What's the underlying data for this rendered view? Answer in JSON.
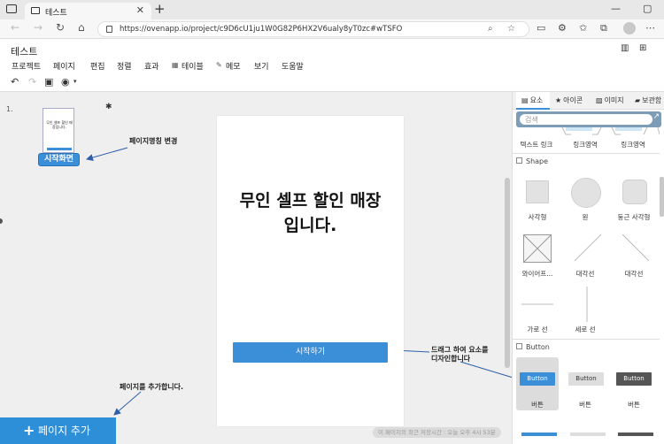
{
  "browser": {
    "tab_title": "테스트",
    "tab_close": "✕",
    "new_tab": "+",
    "window_controls": [
      "—",
      "▢"
    ],
    "url": "https://ovenapp.io/project/c9D6cU1ju1W0G82P6HX2V6ualy8yT0zc#wTSFO",
    "nav": {
      "back": "←",
      "forward": "→",
      "reload": "↻",
      "home": "⌂"
    },
    "toolbar_icons": [
      "search-icon",
      "star-icon",
      "collections-icon",
      "extensions-icon",
      "favorites-icon",
      "profile-icon",
      "more-icon"
    ]
  },
  "app": {
    "title": "테스트",
    "menu": [
      "프로젝트",
      "페이지",
      "편집",
      "정렬",
      "효과",
      "테이블",
      "메모",
      "보기",
      "도움말"
    ],
    "menu_icons": {
      "테이블": "table-icon",
      "메모": "memo-icon"
    },
    "toolbar": [
      "undo-icon",
      "redo-icon",
      "save-icon",
      "preview-icon"
    ]
  },
  "workspace": {
    "page_number": "1.",
    "thumb_title": "무인 셀프 할인 매장입니다.",
    "page_tag": "시작화면",
    "annotations": {
      "page_name_change": "페이지명칭 변경",
      "add_page_hint": "페이지를 추가합니다.",
      "drag_hint_line1": "드래그 하여 요소를",
      "drag_hint_line2": "디자인합니다"
    },
    "canvas": {
      "headline_line1": "무인 셀프 할인 매장",
      "headline_line2": "입니다.",
      "start_button": "시작하기"
    },
    "add_page_button": "페이지 추가",
    "add_page_plus": "+",
    "save_note": "이 페이지의 최근 저장시간 : 오늘 오후 4시 53분"
  },
  "panel": {
    "tabs": [
      {
        "label": "요소",
        "icon": "grid-icon",
        "active": true
      },
      {
        "label": "아이콘",
        "icon": "star-icon",
        "active": false
      },
      {
        "label": "이미지",
        "icon": "image-icon",
        "active": false
      },
      {
        "label": "보관함",
        "icon": "archive-icon",
        "active": false
      }
    ],
    "search_placeholder": "검색",
    "expand_icon": "↗",
    "top_items": [
      "텍스트 링크",
      "링크영역",
      "링크영역"
    ],
    "shape_section": "Shape",
    "shapes": [
      "사각형",
      "원",
      "둥근 사각형",
      "와이어프...",
      "대각선",
      "대각선",
      "가로 선",
      "세로 선"
    ],
    "button_section": "Button",
    "button_sample_text": "Button",
    "buttons": [
      "버튼",
      "버튼",
      "버튼"
    ]
  },
  "colors": {
    "accent": "#3b8ed8",
    "add_page_bg": "#2e8fd9",
    "search_wrap": "#7d9db7",
    "workspace_bg": "#efefef"
  }
}
